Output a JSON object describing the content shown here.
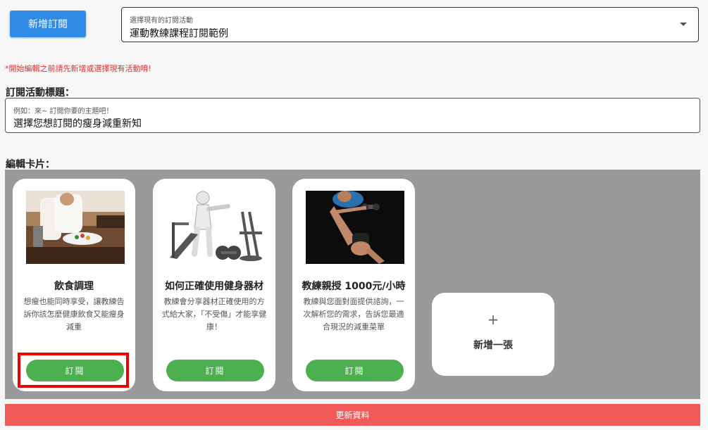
{
  "toolbar": {
    "add_subscription_label": "新增訂閱"
  },
  "activity_select": {
    "label": "選擇現有的訂閱活動",
    "value": "運動教練課程訂閱範例"
  },
  "warning": "*開始編輯之前請先新增或選擇現有活動唷!",
  "title_section": {
    "heading": "訂閱活動標題：",
    "placeholder": "例如：來~ 訂閱你要的主題吧！",
    "value": "選擇您想訂閱的瘦身減重新知"
  },
  "cards_section": {
    "heading": "編輯卡片：",
    "cards": [
      {
        "title": "飲食調理",
        "description": "想瘦也能同時享受，讓教練告訴你該怎麼健康飲食又能瘦身減重",
        "button": "訂閱",
        "image": "cooking-photo"
      },
      {
        "title": "如何正確使用健身器材",
        "description": "教練會分享器材正確使用的方式給大家，「不受傷」才能享健康！",
        "button": "訂閱",
        "image": "gym-equipment-illustration"
      },
      {
        "title": "教練親授 1000元/小時",
        "description": "教練與您面對面提供諮詢，一次解析您的需求，告訴您最適合現況的減重菜單",
        "button": "訂閱",
        "image": "training-photo"
      }
    ],
    "add_card": {
      "icon": "+",
      "label": "新增一張"
    }
  },
  "update_button": "更新資料",
  "colors": {
    "primary": "#2f8be6",
    "subscribe": "#4caf50",
    "update": "#f25a5a",
    "warning": "#e03030",
    "highlight": "#ee0000"
  }
}
